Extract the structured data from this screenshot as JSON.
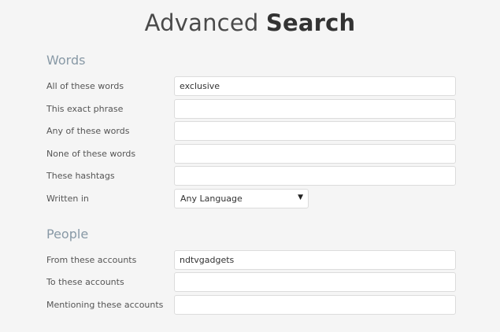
{
  "page": {
    "title_light": "Advanced ",
    "title_bold": "Search"
  },
  "words": {
    "heading": "Words",
    "all_label": "All of these words",
    "all_value": "exclusive",
    "exact_label": "This exact phrase",
    "exact_value": "",
    "any_label": "Any of these words",
    "any_value": "",
    "none_label": "None of these words",
    "none_value": "",
    "hashtags_label": "These hashtags",
    "hashtags_value": "",
    "language_label": "Written in",
    "language_selected": "Any Language",
    "language_caret": "▼"
  },
  "people": {
    "heading": "People",
    "from_label": "From these accounts",
    "from_value": "ndtvgadgets",
    "to_label": "To these accounts",
    "to_value": "",
    "mentioning_label": "Mentioning these accounts",
    "mentioning_value": ""
  },
  "colors": {
    "section_heading": "#8899a6",
    "background": "#f5f5f5",
    "field_border": "#dcdcdc"
  }
}
